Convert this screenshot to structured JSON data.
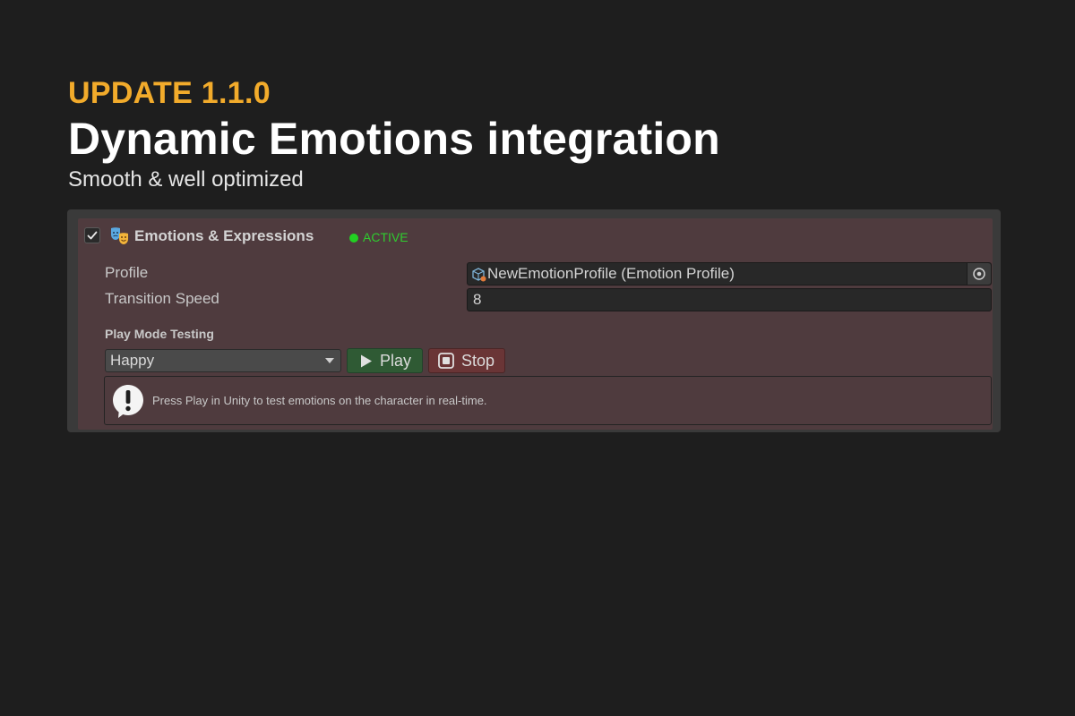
{
  "header": {
    "update_label": "UPDATE 1.1.0",
    "title": "Dynamic Emotions integration",
    "subtitle": "Smooth & well optimized"
  },
  "component": {
    "title": "Emotions & Expressions",
    "enabled": true,
    "icon": "theater-masks-icon",
    "status": "ACTIVE",
    "status_color": "#22d022",
    "fields": {
      "profile": {
        "label": "Profile",
        "value": "NewEmotionProfile (Emotion Profile)",
        "icon": "scriptable-object-icon",
        "picker_icon": "object-picker-icon"
      },
      "transition_speed": {
        "label": "Transition Speed",
        "value": "8"
      }
    },
    "play_mode": {
      "section_label": "Play Mode Testing",
      "emotion_selected": "Happy",
      "play_label": "Play",
      "stop_label": "Stop",
      "play_color": "#2f5a34",
      "stop_color": "#6a3536"
    },
    "help": {
      "icon": "warning-icon",
      "text": "Press Play in Unity to test emotions on the character in real-time."
    }
  },
  "colors": {
    "background": "#1e1e1e",
    "accent": "#f2ab2b",
    "panel": "#3a3a3a",
    "panel_tint": "#4f3b3e"
  }
}
